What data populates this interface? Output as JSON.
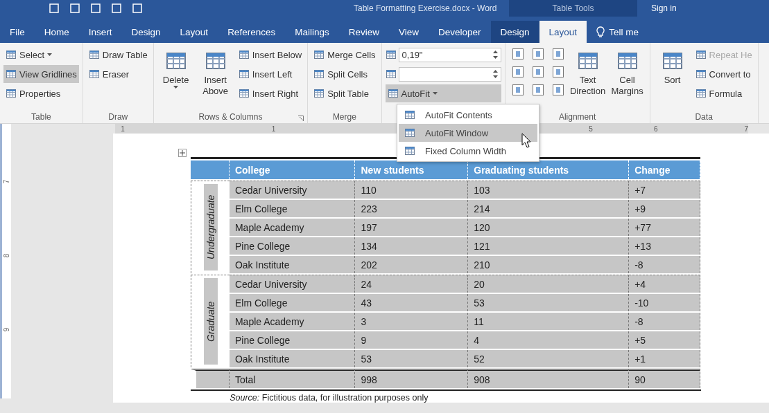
{
  "window": {
    "title": "Table Formatting Exercise.docx  -  Word",
    "context_label": "Table Tools",
    "account": "Sign in"
  },
  "tabs": [
    {
      "label": "File",
      "selected": false,
      "kind": "normal"
    },
    {
      "label": "Home",
      "selected": false,
      "kind": "normal"
    },
    {
      "label": "Insert",
      "selected": false,
      "kind": "normal"
    },
    {
      "label": "Design",
      "selected": false,
      "kind": "normal"
    },
    {
      "label": "Layout",
      "selected": false,
      "kind": "normal"
    },
    {
      "label": "References",
      "selected": false,
      "kind": "normal"
    },
    {
      "label": "Mailings",
      "selected": false,
      "kind": "normal"
    },
    {
      "label": "Review",
      "selected": false,
      "kind": "normal"
    },
    {
      "label": "View",
      "selected": false,
      "kind": "normal"
    },
    {
      "label": "Developer",
      "selected": false,
      "kind": "normal"
    },
    {
      "label": "Design",
      "selected": false,
      "kind": "context"
    },
    {
      "label": "Layout",
      "selected": true,
      "kind": "context"
    },
    {
      "label": "Tell me",
      "selected": false,
      "kind": "search"
    }
  ],
  "ribbon": [
    {
      "label": "Table",
      "columns": [
        [
          {
            "kind": "small",
            "label": "Select",
            "dropdown": true,
            "selected": false
          },
          {
            "kind": "small",
            "label": "View Gridlines",
            "selected": true
          },
          {
            "kind": "small",
            "label": "Properties",
            "selected": false
          }
        ]
      ]
    },
    {
      "label": "Draw",
      "columns": [
        [
          {
            "kind": "small",
            "label": "Draw Table"
          },
          {
            "kind": "small",
            "label": "Eraser"
          }
        ]
      ]
    },
    {
      "label": "Rows & Columns",
      "launcher": true,
      "columns": [
        [
          {
            "kind": "large",
            "label": "Delete",
            "dropdown": true
          }
        ],
        [
          {
            "kind": "large",
            "label": "Insert Above"
          }
        ],
        [
          {
            "kind": "small",
            "label": "Insert Below"
          },
          {
            "kind": "small",
            "label": "Insert Left"
          },
          {
            "kind": "small",
            "label": "Insert Right"
          }
        ]
      ]
    },
    {
      "label": "Merge",
      "columns": [
        [
          {
            "kind": "small",
            "label": "Merge Cells"
          },
          {
            "kind": "small",
            "label": "Split Cells"
          },
          {
            "kind": "small",
            "label": "Split Table"
          }
        ]
      ]
    },
    {
      "columns": [
        [
          {
            "kind": "spin",
            "value": "0,19\""
          },
          {
            "kind": "spin"
          },
          {
            "kind": "small",
            "label": "AutoFit",
            "dropdown": true,
            "expanded": true
          }
        ]
      ]
    },
    {
      "label": "Alignment",
      "columns": [
        [
          {
            "kind": "icon"
          },
          {
            "kind": "icon"
          },
          {
            "kind": "icon"
          }
        ],
        [
          {
            "kind": "icon"
          },
          {
            "kind": "icon"
          },
          {
            "kind": "icon"
          }
        ],
        [
          {
            "kind": "icon"
          },
          {
            "kind": "icon"
          },
          {
            "kind": "icon"
          }
        ],
        [
          {
            "kind": "large",
            "label": "Text Direction"
          }
        ],
        [
          {
            "kind": "large",
            "label": "Cell Margins"
          }
        ]
      ]
    },
    {
      "label": "Data",
      "columns": [
        [
          {
            "kind": "large",
            "label": "Sort"
          }
        ],
        [
          {
            "kind": "small",
            "label": "Repeat He",
            "disabled": true
          },
          {
            "kind": "small",
            "label": "Convert to",
            "disabled": false
          },
          {
            "kind": "small",
            "label": "Formula",
            "disabled": false
          }
        ]
      ]
    }
  ],
  "ruler": {
    "labels": [
      "1",
      "1",
      "5",
      "6",
      "7"
    ],
    "vertical_labels": [
      "7",
      "8",
      "9"
    ]
  },
  "autofit_menu": [
    {
      "label": "AutoFit Contents",
      "selected": false
    },
    {
      "label": "AutoFit Window",
      "selected": true
    },
    {
      "label": "Fixed Column Width",
      "selected": false
    }
  ],
  "table": {
    "columns": [
      "College",
      "New students",
      "Graduating students",
      "Change"
    ],
    "groups": [
      {
        "label": "Undergraduate",
        "rows": [
          [
            "Cedar University",
            "110",
            "103",
            "+7"
          ],
          [
            "Elm College",
            "223",
            "214",
            "+9"
          ],
          [
            "Maple Academy",
            "197",
            "120",
            "+77"
          ],
          [
            "Pine College",
            "134",
            "121",
            "+13"
          ],
          [
            "Oak Institute",
            "202",
            "210",
            "-8"
          ]
        ]
      },
      {
        "label": "Graduate",
        "rows": [
          [
            "Cedar University",
            "24",
            "20",
            "+4"
          ],
          [
            "Elm College",
            "43",
            "53",
            "-10"
          ],
          [
            "Maple Academy",
            "3",
            "11",
            "-8"
          ],
          [
            "Pine College",
            "9",
            "4",
            "+5"
          ],
          [
            "Oak Institute",
            "53",
            "52",
            "+1"
          ]
        ]
      }
    ],
    "total": [
      "Total",
      "998",
      "908",
      "90"
    ],
    "source": "*Source:* Fictitious data, for illustration purposes only"
  }
}
